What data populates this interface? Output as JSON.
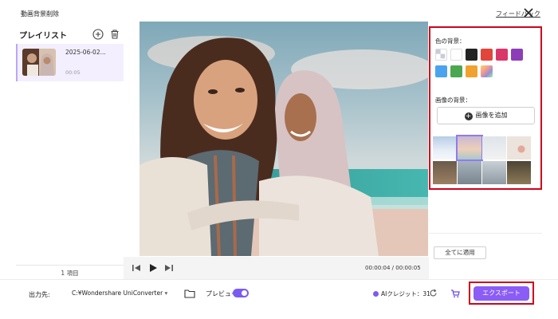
{
  "window": {
    "title": "動画背景削除",
    "feedback_label": "フィードバック",
    "close_icon": "close-icon"
  },
  "playlist": {
    "title": "プレイリスト",
    "add_icon": "add-circle-icon",
    "delete_icon": "trash-icon",
    "items": [
      {
        "name": "2025-06-02...",
        "duration": "00:05"
      }
    ],
    "count_label": "1 項目"
  },
  "player": {
    "time": "00:00:04 / 00:00:05",
    "prev_icon": "previous-frame-icon",
    "play_icon": "play-icon",
    "next_icon": "next-frame-icon"
  },
  "background_panel": {
    "color_label": "色の背景：",
    "colors": [
      "transparent",
      "#ffffff",
      "#222222",
      "#e2453a",
      "#d9366a",
      "#8e3db8",
      "#4ba3ee",
      "#4ca850",
      "#f0a231",
      "gradient"
    ],
    "image_label": "画像の背景：",
    "add_image_label": "画像を追加",
    "thumbnails": [
      "snow-landscape",
      "beach-sunset",
      "winter-field",
      "flowers",
      "living-room",
      "city-street",
      "office",
      "library"
    ],
    "selected_thumbnail": 1,
    "apply_all_label": "全てに適用"
  },
  "bottom": {
    "output_label": "出力先:",
    "output_path": "C:¥Wondershare UniConverter",
    "preview_label": "プレビュー",
    "preview_on": true,
    "credit_label": "AIクレジット：31",
    "export_label": "エクスポート"
  },
  "colors": {
    "accent": "#8b5cf6",
    "highlight_box": "#d0021b"
  }
}
